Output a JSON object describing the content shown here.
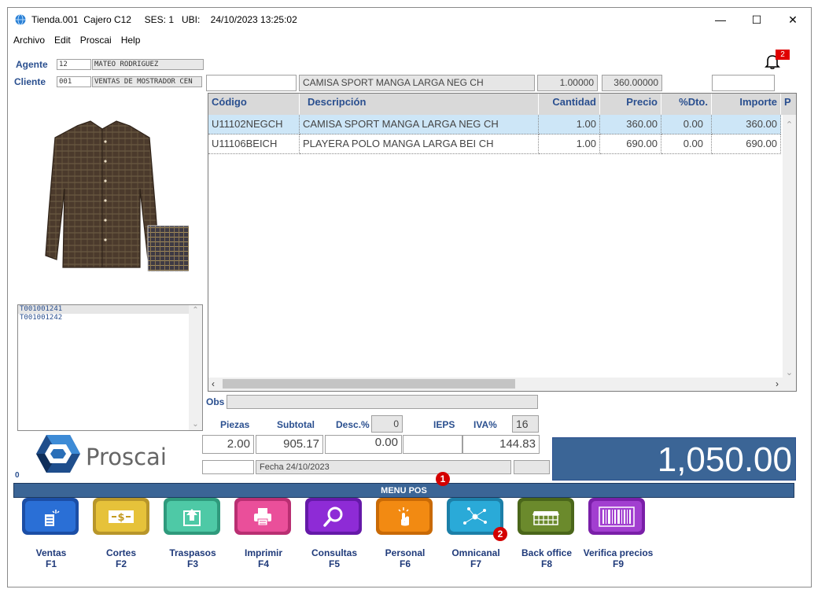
{
  "window": {
    "title": "Tienda.001  Cajero C12     SES: 1   UBI:    24/10/2023 13:25:02",
    "minimize": "—",
    "maximize": "☐",
    "close": "✕"
  },
  "menu": [
    "Archivo",
    "Edit",
    "Proscai",
    "Help"
  ],
  "agent": {
    "label": "Agente",
    "code": "12",
    "name": "MATEO RODRIGUEZ"
  },
  "client": {
    "label": "Cliente",
    "code": "001",
    "name": "VENTAS DE MOSTRADOR CEN"
  },
  "notification": {
    "count": "2"
  },
  "item_entry": {
    "code": "",
    "description": "CAMISA SPORT MANGA LARGA NEG CH",
    "quantity": "1.00000",
    "price": "360.00000",
    "extra": ""
  },
  "grid": {
    "columns": [
      "Código",
      "Descripción",
      "Cantidad",
      "Precio",
      "%Dto.",
      "Importe",
      "P"
    ],
    "rows": [
      {
        "code": "U11102NEGCH",
        "description": "CAMISA SPORT MANGA LARGA NEG CH",
        "qty": "1.00",
        "price": "360.00",
        "disc": "0.00",
        "amount": "360.00",
        "selected": true
      },
      {
        "code": "U11106BEICH",
        "description": "PLAYERA POLO MANGA LARGA BEI CH",
        "qty": "1.00",
        "price": "690.00",
        "disc": "0.00",
        "amount": "690.00",
        "selected": false
      }
    ]
  },
  "tickets": [
    "T001001241",
    "T001001242"
  ],
  "obs_label": "Obs",
  "totals": {
    "pieces_label": "Piezas",
    "subtotal_label": "Subtotal",
    "desc_label": "Desc.%",
    "desc_pct": "0",
    "ieps_label": "IEPS",
    "iva_label": "IVA%",
    "iva_pct": "16",
    "pieces": "2.00",
    "subtotal": "905.17",
    "discount": "0.00",
    "ieps": "",
    "iva": "144.83",
    "date": "Fecha 24/10/2023",
    "grand_total": "1,050.00"
  },
  "logo": {
    "name": "Proscai"
  },
  "status_zero": "0",
  "menu_pos": {
    "label": "MENU POS",
    "badge": "1"
  },
  "omni_badge": "2",
  "functions": [
    {
      "name": "Ventas",
      "key": "F1",
      "color": "#2a6fd6",
      "icon": "sales-icon"
    },
    {
      "name": "Cortes",
      "key": "F2",
      "color": "#e6c23a",
      "icon": "cash-cut-icon"
    },
    {
      "name": "Traspasos",
      "key": "F3",
      "color": "#4ec9a6",
      "icon": "transfer-icon"
    },
    {
      "name": "Imprimir",
      "key": "F4",
      "color": "#ea4f9a",
      "icon": "printer-icon"
    },
    {
      "name": "Consultas",
      "key": "F5",
      "color": "#8e2bd6",
      "icon": "search-icon"
    },
    {
      "name": "Personal",
      "key": "F6",
      "color": "#f28a12",
      "icon": "touch-icon"
    },
    {
      "name": "Omnicanal",
      "key": "F7",
      "color": "#2aaad8",
      "icon": "network-icon"
    },
    {
      "name": "Back office",
      "key": "F8",
      "color": "#6b8a2c",
      "icon": "building-icon"
    },
    {
      "name": "Verifica precios",
      "key": "F9",
      "color": "#a23fd0",
      "icon": "barcode-icon"
    }
  ]
}
